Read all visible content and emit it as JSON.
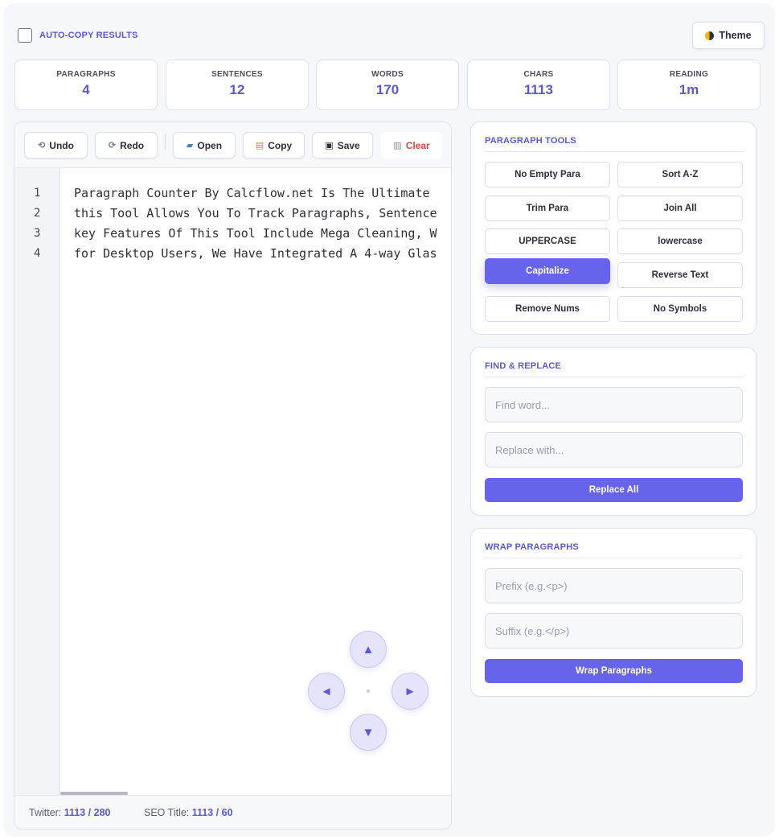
{
  "header": {
    "auto_copy_label": "AUTO-COPY RESULTS",
    "theme_label": "Theme"
  },
  "stats": [
    {
      "label": "PARAGRAPHS",
      "value": "4"
    },
    {
      "label": "SENTENCES",
      "value": "12"
    },
    {
      "label": "WORDS",
      "value": "170"
    },
    {
      "label": "CHARS",
      "value": "1113"
    },
    {
      "label": "READING",
      "value": "1m"
    }
  ],
  "toolbar": {
    "undo": "Undo",
    "redo": "Redo",
    "open": "Open",
    "copy": "Copy",
    "save": "Save",
    "clear": "Clear"
  },
  "editor": {
    "line_numbers": [
      "1",
      "2",
      "3",
      "4"
    ],
    "lines": [
      "Paragraph Counter By Calcflow.net Is The Ultimate",
      "this Tool Allows You To Track Paragraphs, Sentence",
      "key Features Of This Tool Include Mega Cleaning, W",
      "for Desktop Users, We Have Integrated A 4-way Glas"
    ]
  },
  "status": {
    "twitter_label": "Twitter:",
    "twitter_value": "1113 / 280",
    "seo_label": "SEO Title:",
    "seo_value": "1113 / 60"
  },
  "joystick": {
    "up": "▲",
    "down": "▼",
    "left": "◄",
    "right": "►"
  },
  "paragraph_tools": {
    "title": "PARAGRAPH TOOLS",
    "buttons": [
      "No Empty Para",
      "Sort A-Z",
      "Trim Para",
      "Join All",
      "UPPERCASE",
      "lowercase",
      "Capitalize",
      "Reverse Text",
      "Remove Nums",
      "No Symbols"
    ],
    "active": "Capitalize"
  },
  "find_replace": {
    "title": "FIND & REPLACE",
    "find_placeholder": "Find word...",
    "replace_placeholder": "Replace with...",
    "button": "Replace All"
  },
  "wrap": {
    "title": "WRAP PARAGRAPHS",
    "prefix_placeholder": "Prefix (e.g.<p>)",
    "suffix_placeholder": "Suffix (e.g.</p>)",
    "button": "Wrap Paragraphs"
  },
  "colors": {
    "accent": "#6763ec",
    "accent_text": "#5b58d6",
    "danger": "#d9483b"
  },
  "icons": {
    "undo": "undo-icon",
    "redo": "redo-icon",
    "open": "folder-icon",
    "copy": "clipboard-icon",
    "save": "floppy-disk-icon",
    "clear": "trash-icon",
    "theme": "half-moon-icon"
  }
}
